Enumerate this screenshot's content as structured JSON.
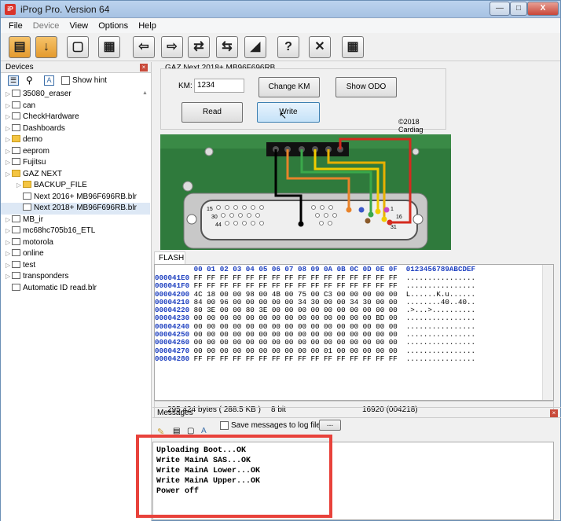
{
  "window": {
    "title": "iProg Pro. Version 64",
    "icon_text": "iP",
    "min_label": "—",
    "max_label": "□",
    "close_label": "X"
  },
  "menu": [
    "File",
    "Device",
    "View",
    "Options",
    "Help"
  ],
  "toolbar": {
    "icons": [
      "open-folder-icon",
      "save-icon",
      "blank-page-icon",
      "chip-icon",
      "read-arrow-icon",
      "write-arrow-icon",
      "compare-icon",
      "verify-icon",
      "device-check-icon",
      "help-icon",
      "close-x-icon",
      "calculator-icon"
    ],
    "glyphs": [
      "▤",
      "↓",
      "▢",
      "▦",
      "⇦",
      "⇨",
      "⇄",
      "⇆",
      "◢",
      "?",
      "✕",
      "▦"
    ]
  },
  "devices": {
    "title": "Devices",
    "show_hint": "Show hint",
    "tree": [
      {
        "label": "35080_eraser",
        "level": 0,
        "icon": "chip-icon"
      },
      {
        "label": "can",
        "level": 0,
        "icon": "plug-icon"
      },
      {
        "label": "CheckHardware",
        "level": 0,
        "icon": "wrench-icon"
      },
      {
        "label": "Dashboards",
        "level": 0,
        "icon": "gauge-icon"
      },
      {
        "label": "demo",
        "level": 0,
        "icon": "folder-icon"
      },
      {
        "label": "eeprom",
        "level": 0,
        "icon": "chip-icon"
      },
      {
        "label": "Fujitsu",
        "level": 0,
        "icon": "chip-icon"
      },
      {
        "label": "GAZ NEXT",
        "level": 0,
        "icon": "folder-open-icon"
      },
      {
        "label": "BACKUP_FILE",
        "level": 1,
        "icon": "folder-icon"
      },
      {
        "label": "Next 2016+ MB96F696RB.blr",
        "level": 1,
        "icon": "file-icon"
      },
      {
        "label": "Next 2018+ MB96F696RB.blr",
        "level": 1,
        "icon": "file-icon",
        "selected": true
      },
      {
        "label": "MB_ir",
        "level": 0,
        "icon": "chip-icon"
      },
      {
        "label": "mc68hc705b16_ETL",
        "level": 0,
        "icon": "chip-icon"
      },
      {
        "label": "motorola",
        "level": 0,
        "icon": "chip-icon"
      },
      {
        "label": "online",
        "level": 0,
        "icon": "cloud-icon"
      },
      {
        "label": "test",
        "level": 0,
        "icon": "file-icon"
      },
      {
        "label": "transponders",
        "level": 0,
        "icon": "radio-icon"
      },
      {
        "label": "Automatic ID read.blr",
        "level": 0,
        "icon": "file-icon"
      }
    ]
  },
  "device_panel": {
    "title": "GAZ Next 2018+ MB96F696RB",
    "km_label": "KM:",
    "km_value": "1234",
    "change_km": "Change KM",
    "show_odo": "Show ODO",
    "read": "Read",
    "write": "Write",
    "copyright": "©2018 Cardiag"
  },
  "connector": {
    "pin_labels": [
      "15",
      "30",
      "44",
      "1",
      "16",
      "31"
    ]
  },
  "flash": {
    "tab": "FLASH",
    "header": "         00 01 02 03 04 05 06 07 08 09 0A 0B 0C 0D 0E 0F  0123456789ABCDEF",
    "rows": [
      {
        "addr": "000041E0",
        "bytes": "FF FF FF FF FF FF FF FF FF FF FF FF FF FF FF FF",
        "ascii": "................"
      },
      {
        "addr": "000041F0",
        "bytes": "FF FF FF FF FF FF FF FF FF FF FF FF FF FF FF FF",
        "ascii": "................"
      },
      {
        "addr": "00004200",
        "bytes": "4C 18 00 00 98 00 4B 00 75 00 C3 00 00 00 00 00",
        "ascii": "L......K.u......"
      },
      {
        "addr": "00004210",
        "bytes": "84 00 96 00 00 00 00 00 34 30 00 00 34 30 00 00",
        "ascii": "........40..40.."
      },
      {
        "addr": "00004220",
        "bytes": "80 3E 00 00 80 3E 00 00 00 00 00 00 00 00 00 00",
        "ascii": ".>...>.........."
      },
      {
        "addr": "00004230",
        "bytes": "00 00 00 00 00 00 00 00 00 00 00 00 00 00 BD 00",
        "ascii": "................"
      },
      {
        "addr": "00004240",
        "bytes": "00 00 00 00 00 00 00 00 00 00 00 00 00 00 00 00",
        "ascii": "................"
      },
      {
        "addr": "00004250",
        "bytes": "00 00 00 00 00 00 00 00 00 00 00 00 00 00 00 00",
        "ascii": "................"
      },
      {
        "addr": "00004260",
        "bytes": "00 00 00 00 00 00 00 00 00 00 00 00 00 00 00 00",
        "ascii": "................"
      },
      {
        "addr": "00004270",
        "bytes": "00 00 00 00 00 00 00 00 00 00 01 00 00 00 00 00",
        "ascii": "................"
      },
      {
        "addr": "00004280",
        "bytes": "FF FF FF FF FF FF FF FF FF FF FF FF FF FF FF FF",
        "ascii": "................"
      }
    ],
    "status_size": "295,424 bytes ( 288.5 KB )",
    "status_bits": "8 bit",
    "status_pos": "16920 (004218)"
  },
  "messages": {
    "title": "Messages",
    "save_log": "Save messages to log file",
    "browse": "...",
    "lines": [
      "Uploading Boot...OK",
      "Write MainA SAS...OK",
      "Write MainA Lower...OK",
      "Write MainA Upper...OK",
      "Power off"
    ]
  },
  "colors": {
    "highlight": "#e8423b",
    "hex_blue": "#1e40c0",
    "board_green": "#2f7a3c"
  }
}
